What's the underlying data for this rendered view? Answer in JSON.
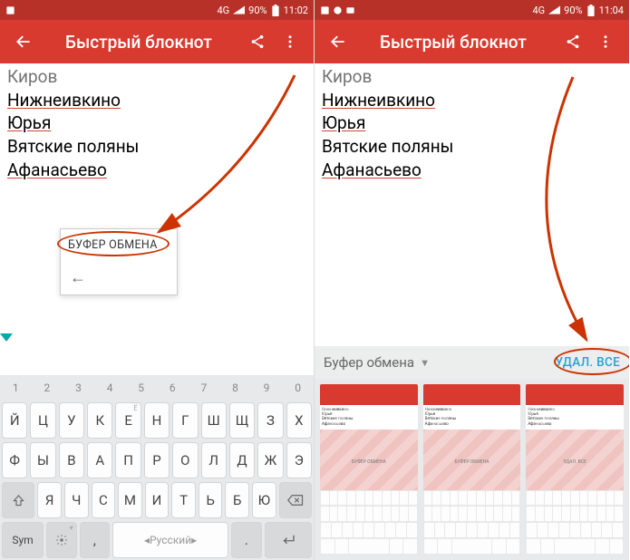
{
  "status": {
    "left_time": "11:02",
    "right_time": "11:04",
    "battery": "90%",
    "network": "4G"
  },
  "app": {
    "title": "Быстрый блокнот"
  },
  "note_lines": {
    "l0": "Киров",
    "l1": "Нижнеивкино",
    "l2": "Юрья",
    "l3": "Вятские поляны",
    "l4": "Афанасьево"
  },
  "popup": {
    "label": "БУФЕР ОБМЕНА"
  },
  "keyboard": {
    "nums": [
      "1",
      "2",
      "3",
      "4",
      "5",
      "6",
      "7",
      "8",
      "9",
      "0"
    ],
    "row1": [
      "Й",
      "Ц",
      "У",
      "К",
      "Е",
      "Н",
      "Г",
      "Ш",
      "Щ",
      "З",
      "Х"
    ],
    "row2": [
      "Ф",
      "Ы",
      "В",
      "А",
      "П",
      "Р",
      "О",
      "Л",
      "Д",
      "Ж",
      "Э"
    ],
    "row3": [
      "Я",
      "Ч",
      "С",
      "М",
      "И",
      "Т",
      "Ь",
      "Б",
      "Ю"
    ],
    "row4": {
      "sym": "Sym",
      "lang": "Русский"
    }
  },
  "clipboard": {
    "title": "Буфер обмена",
    "delete_all": "УДАЛ. ВСЕ",
    "thumb_labels": {
      "a": "БУФЕР ОБМЕНА",
      "b": "БУФЕР ОБМЕНА",
      "c": "УДАЛ. ВСЕ"
    }
  }
}
